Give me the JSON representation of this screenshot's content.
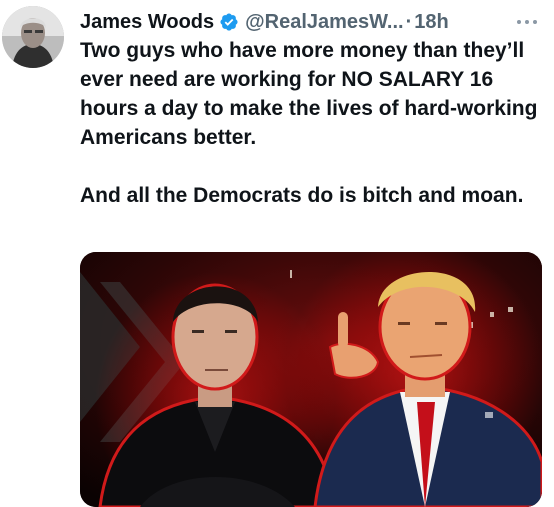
{
  "tweet": {
    "author_name": "James Woods",
    "author_handle": "@RealJamesW...",
    "separator": "·",
    "timestamp": "18h",
    "paragraphs": [
      "Two guys who have more money than they’ll ever need are working for NO SALARY 16 hours a day to make the lives of hard-working Americans better.",
      "And all the Democrats do is bitch and moan."
    ]
  },
  "icons": {
    "verified": "verified-badge-icon",
    "more": "more-options-icon"
  },
  "colors": {
    "verified_blue": "#1d9bf0",
    "secondary_text": "#536471",
    "primary_text": "#0f1419"
  }
}
